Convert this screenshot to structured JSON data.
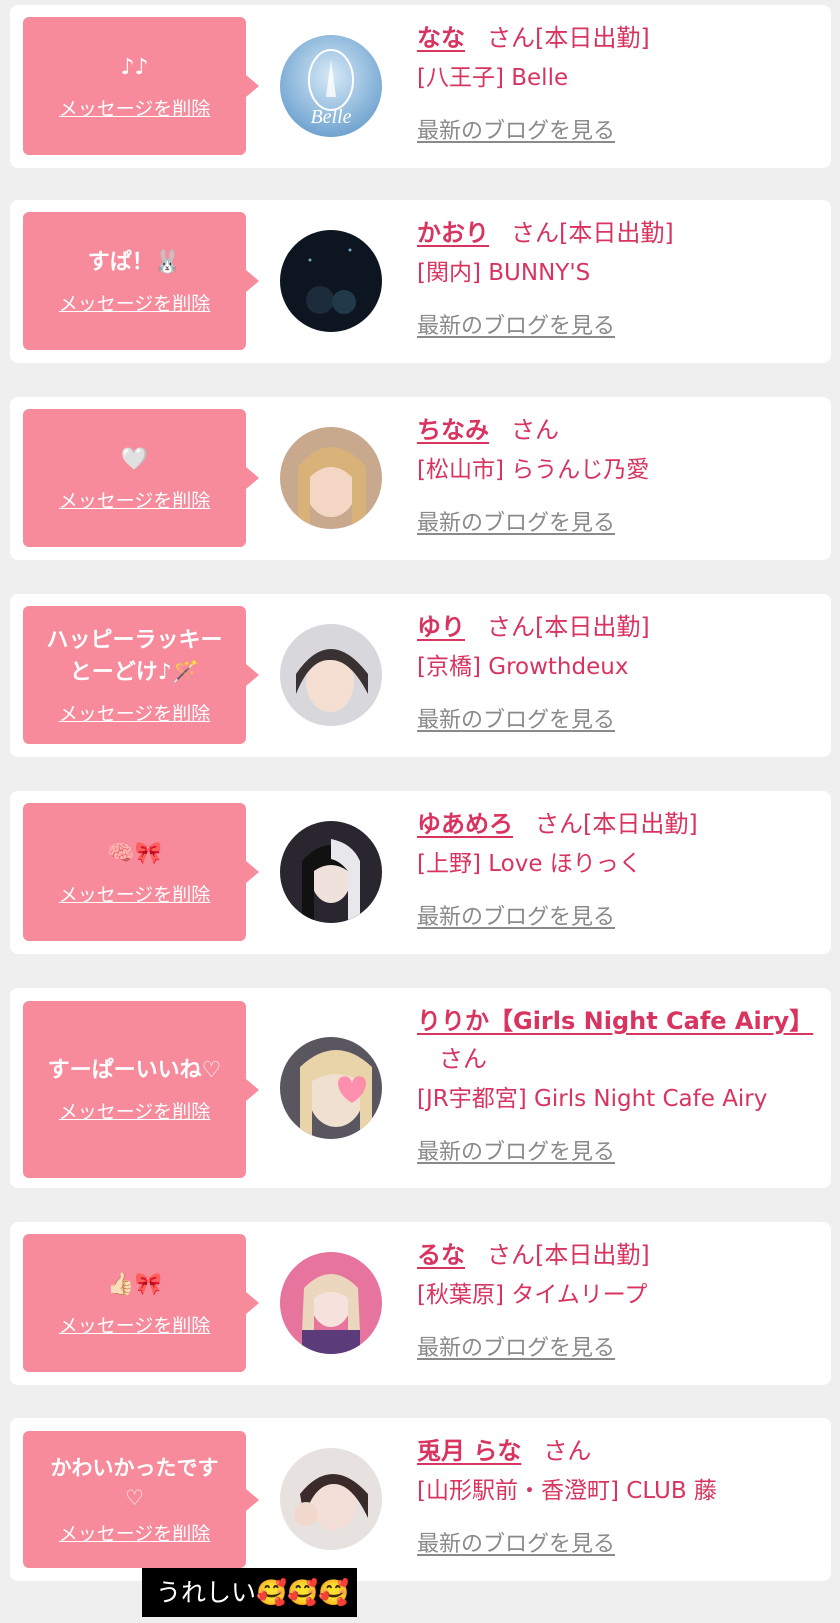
{
  "delete_label": "メッセージを削除",
  "blog_label": "最新のブログを見る",
  "san": "さん",
  "working_today": "[本日出勤]",
  "caption": "うれしい🥰🥰🥰",
  "entries": [
    {
      "message": "♪♪",
      "name": "なな",
      "working": true,
      "shop": "[八王子] Belle"
    },
    {
      "message": "すぱ！🐰",
      "name": "かおり",
      "working": true,
      "shop": "[関内] BUNNY'S"
    },
    {
      "message": "🤍",
      "name": "ちなみ",
      "working": false,
      "shop": "[松山市] らうんじ乃愛"
    },
    {
      "message": "ハッピーラッキー\nとーどけ♪🪄",
      "name": "ゆり",
      "working": true,
      "shop": "[京橋] Growthdeux"
    },
    {
      "message": "🧠🎀",
      "name": "ゆあめろ",
      "working": true,
      "shop": "[上野] Love ほりっく"
    },
    {
      "message": "すーぱーいいね♡",
      "name": "りりか【Girls Night Cafe Airy】",
      "working": false,
      "shop": "[JR宇都宮] Girls Night Cafe Airy"
    },
    {
      "message": "👍🏻🎀",
      "name": "るな",
      "working": true,
      "shop": "[秋葉原] タイムリープ"
    },
    {
      "message": "かわいかったです\n♡",
      "name": "兎月 らな",
      "working": false,
      "shop": "[山形駅前・香澄町] CLUB 藤"
    }
  ],
  "colors": {
    "bubble": "#f78a9b",
    "accent": "#d8345f",
    "link_gray": "#8a8a8a",
    "background": "#efefef"
  }
}
